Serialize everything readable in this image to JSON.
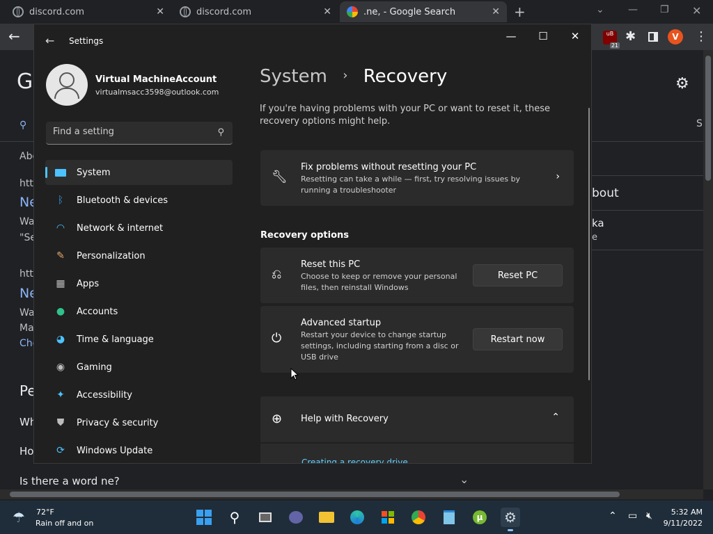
{
  "browser": {
    "tabs": [
      {
        "title": "discord.com"
      },
      {
        "title": "discord.com"
      },
      {
        "title": ".ne, - Google Search"
      }
    ],
    "ublock_count": "21",
    "profile_initial": "V"
  },
  "google_page": {
    "logo_partial": "G",
    "lines": {
      "abo": "Abo",
      "http1": "http",
      "ne1": "Ne",
      "wa1": "Wa",
      "se": "\"Se",
      "http2": "http",
      "ne2": "Ne",
      "wa2": "Wa",
      "ma": "Ma",
      "cho": "Cho",
      "pe": "Pe",
      "wh": "Wh",
      "ho": "Ho",
      "word_question": "Is there a word ne?",
      "right_s": "S",
      "bout": "bout",
      "ka": "ka",
      "e": "e"
    }
  },
  "settings": {
    "window_title": "Settings",
    "account": {
      "name": "Virtual MachineAccount",
      "email": "virtualmsacc3598@outlook.com"
    },
    "search_placeholder": "Find a setting",
    "nav": [
      {
        "label": "System",
        "icon": "system-icon",
        "color": "#4cc2ff"
      },
      {
        "label": "Bluetooth & devices",
        "icon": "bluetooth-icon",
        "color": "#3a96dd"
      },
      {
        "label": "Network & internet",
        "icon": "wifi-icon",
        "color": "#4cc2ff"
      },
      {
        "label": "Personalization",
        "icon": "brush-icon",
        "color": "#e8a86b"
      },
      {
        "label": "Apps",
        "icon": "apps-icon",
        "color": "#bcbcbc"
      },
      {
        "label": "Accounts",
        "icon": "person-icon",
        "color": "#2fc28a"
      },
      {
        "label": "Time & language",
        "icon": "globe-clock-icon",
        "color": "#4cc2ff"
      },
      {
        "label": "Gaming",
        "icon": "gamepad-icon",
        "color": "#bcbcbc"
      },
      {
        "label": "Accessibility",
        "icon": "accessibility-icon",
        "color": "#4cc2ff"
      },
      {
        "label": "Privacy & security",
        "icon": "shield-icon",
        "color": "#bcbcbc"
      },
      {
        "label": "Windows Update",
        "icon": "update-icon",
        "color": "#4cc2ff"
      }
    ],
    "breadcrumb": {
      "parent": "System",
      "separator": "›",
      "current": "Recovery"
    },
    "intro": "If you're having problems with your PC or want to reset it, these recovery options might help.",
    "fix_card": {
      "title": "Fix problems without resetting your PC",
      "desc": "Resetting can take a while — first, try resolving issues by running a troubleshooter"
    },
    "section_title": "Recovery options",
    "reset_card": {
      "title": "Reset this PC",
      "desc": "Choose to keep or remove your personal files, then reinstall Windows",
      "button": "Reset PC"
    },
    "advanced_card": {
      "title": "Advanced startup",
      "desc": "Restart your device to change startup settings, including starting from a disc or USB drive",
      "button": "Restart now"
    },
    "help_card": {
      "title": "Help with Recovery",
      "link": "Creating a recovery drive"
    }
  },
  "taskbar": {
    "weather": {
      "temp": "72°F",
      "desc": "Rain off and on"
    },
    "clock": {
      "time": "5:32 AM",
      "date": "9/11/2022"
    }
  }
}
